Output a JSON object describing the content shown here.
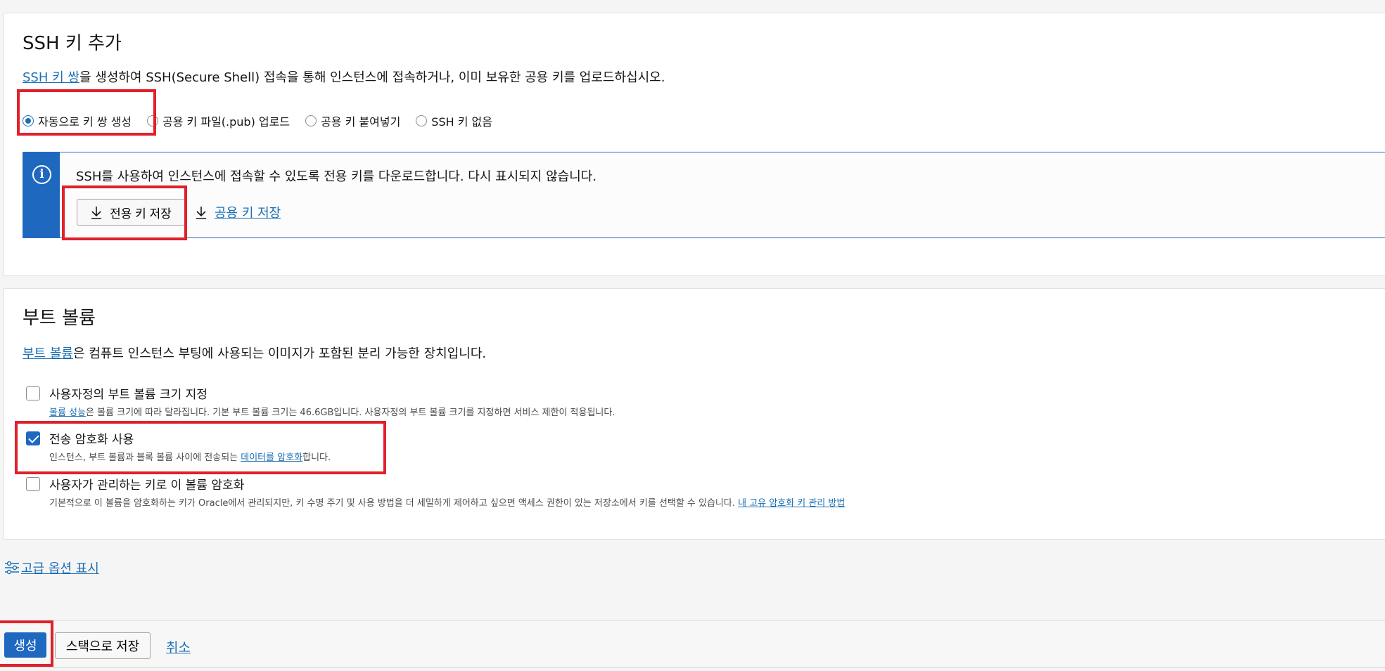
{
  "ssh": {
    "title": "SSH 키 추가",
    "desc_link": "SSH 키 쌍",
    "desc_text": "을 생성하여 SSH(Secure Shell) 접속을 통해 인스턴스에 접속하거나, 이미 보유한 공용 키를 업로드하십시오.",
    "options": [
      {
        "label": "자동으로 키 쌍 생성",
        "selected": true
      },
      {
        "label": "공용 키 파일(.pub) 업로드",
        "selected": false
      },
      {
        "label": "공용 키 붙여넣기",
        "selected": false
      },
      {
        "label": "SSH 키 없음",
        "selected": false
      }
    ],
    "info_icon": "info-icon",
    "info_text": "SSH를 사용하여 인스턴스에 접속할 수 있도록 전용 키를 다운로드합니다. 다시 표시되지 않습니다.",
    "save_private_label": "전용 키 저장",
    "save_public_label": "공용 키 저장"
  },
  "boot": {
    "title": "부트 볼륨",
    "desc_link": "부트 볼륨",
    "desc_text": "은 컴퓨트 인스턴스 부팅에 사용되는 이미지가 포함된 분리 가능한 장치입니다.",
    "custom_size": {
      "label": "사용자정의 부트 볼륨 크기 지정",
      "help_link": "볼륨 성능",
      "help_text": "은 볼륨 크기에 따라 달라집니다. 기본 부트 볼륨 크기는 46.6GB입니다. 사용자정의 부트 볼륨 크기를 지정하면 서비스 제한이 적용됩니다.",
      "checked": false
    },
    "in_transit": {
      "label": "전송 암호화 사용",
      "help_prefix": "인스턴스, 부트 볼륨과 블록 볼륨 사이에 전송되는 ",
      "help_link": "데이터를 암호화",
      "help_suffix": "합니다.",
      "checked": true
    },
    "customer_key": {
      "label": "사용자가 관리하는 키로 이 볼륨 암호화",
      "help_text": "기본적으로 이 볼륨을 암호화하는 키가 Oracle에서 관리되지만, 키 수명 주기 및 사용 방법을 더 세밀하게 제어하고 싶으면 액세스 권한이 있는 저장소에서 키를 선택할 수 있습니다.",
      "help_link": "내 고유 암호화 키 관리 방법",
      "checked": false
    }
  },
  "advanced_link": "고급 옵션 표시",
  "footer": {
    "create_label": "생성",
    "save_stack_label": "스택으로 저장",
    "cancel_label": "취소"
  },
  "colors": {
    "accent": "#1e68c0",
    "link": "#1a6fb5",
    "highlight": "#e0202a"
  }
}
